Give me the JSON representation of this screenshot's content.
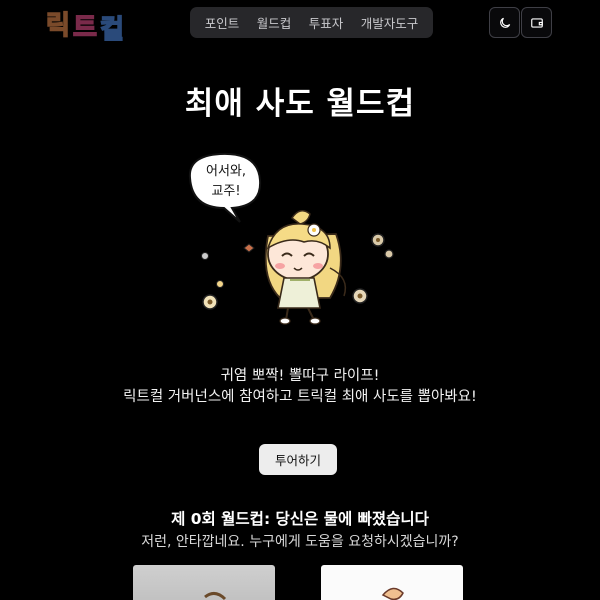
{
  "header": {
    "logo_text": "릭트컬",
    "nav": [
      {
        "label": "포인트"
      },
      {
        "label": "월드컵"
      },
      {
        "label": "투표자"
      },
      {
        "label": "개발자도구"
      }
    ],
    "icons": [
      "moon-icon",
      "wallet-icon"
    ]
  },
  "hero": {
    "title": "최애 사도 월드컵",
    "bubble_line1": "어서와,",
    "bubble_line2": "교주!",
    "tagline_1": "귀염 뽀짝! 뽈따구 라이프!",
    "tagline_2": "릭트컬 거버넌스에 참여하고 트릭컬 최애 사도를 뽑아봐요!",
    "tour_button": "투어하기"
  },
  "round": {
    "title": "제 0회 월드컵: 당신은 물에 빠졌습니다",
    "subtitle": "저런, 안타깝네요. 누구에게 도움을 요청하시겠습니까?"
  },
  "colors": {
    "background": "#000000",
    "nav_bg": "#27272a",
    "button_bg": "#ededed"
  }
}
